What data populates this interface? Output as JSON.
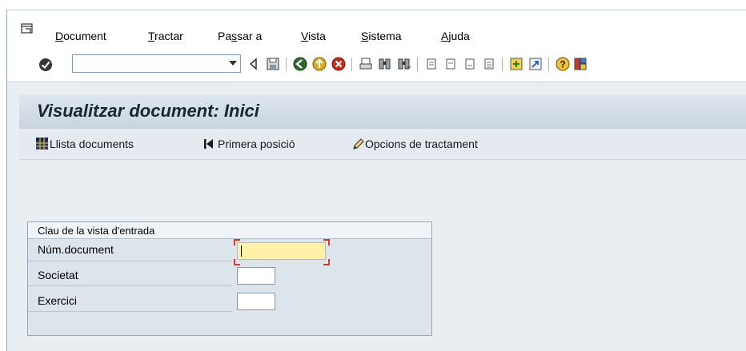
{
  "menu": {
    "items": [
      {
        "pre": "",
        "u": "D",
        "post": "ocument"
      },
      {
        "pre": "",
        "u": "T",
        "post": "ractar"
      },
      {
        "pre": "Pa",
        "u": "s",
        "post": "sar a"
      },
      {
        "pre": "",
        "u": "V",
        "post": "ista"
      },
      {
        "pre": "",
        "u": "S",
        "post": "istema"
      },
      {
        "pre": "",
        "u": "A",
        "post": "juda"
      }
    ]
  },
  "toolbar": {
    "command_field_value": "",
    "icons": [
      "enter-icon",
      "back-arrow-icon",
      "save-icon",
      "back-icon",
      "exit-icon",
      "cancel-icon",
      "print-icon",
      "find-icon",
      "find-next-icon",
      "first-page-icon",
      "previous-page-icon",
      "next-page-icon",
      "last-page-icon",
      "new-session-icon",
      "shortcut-icon",
      "help-icon",
      "layout-icon"
    ]
  },
  "screen": {
    "title": "Visualitzar document: Inici"
  },
  "app_toolbar": {
    "list_label": "Llista documents",
    "first_position_label": "Primera posició",
    "options_label": "Opcions de tractament"
  },
  "entry_group": {
    "title": "Clau de la vista d'entrada",
    "fields": [
      {
        "label": "Núm.document",
        "value": ""
      },
      {
        "label": "Societat",
        "value": ""
      },
      {
        "label": "Exercici",
        "value": ""
      }
    ]
  },
  "colors": {
    "title_gradient_top": "#dfe7ef",
    "title_gradient_bottom": "#c9d4df",
    "panel_bg": "#e9eef3",
    "focused_field": "#fff2a8",
    "focus_corners": "#d23b2a"
  }
}
